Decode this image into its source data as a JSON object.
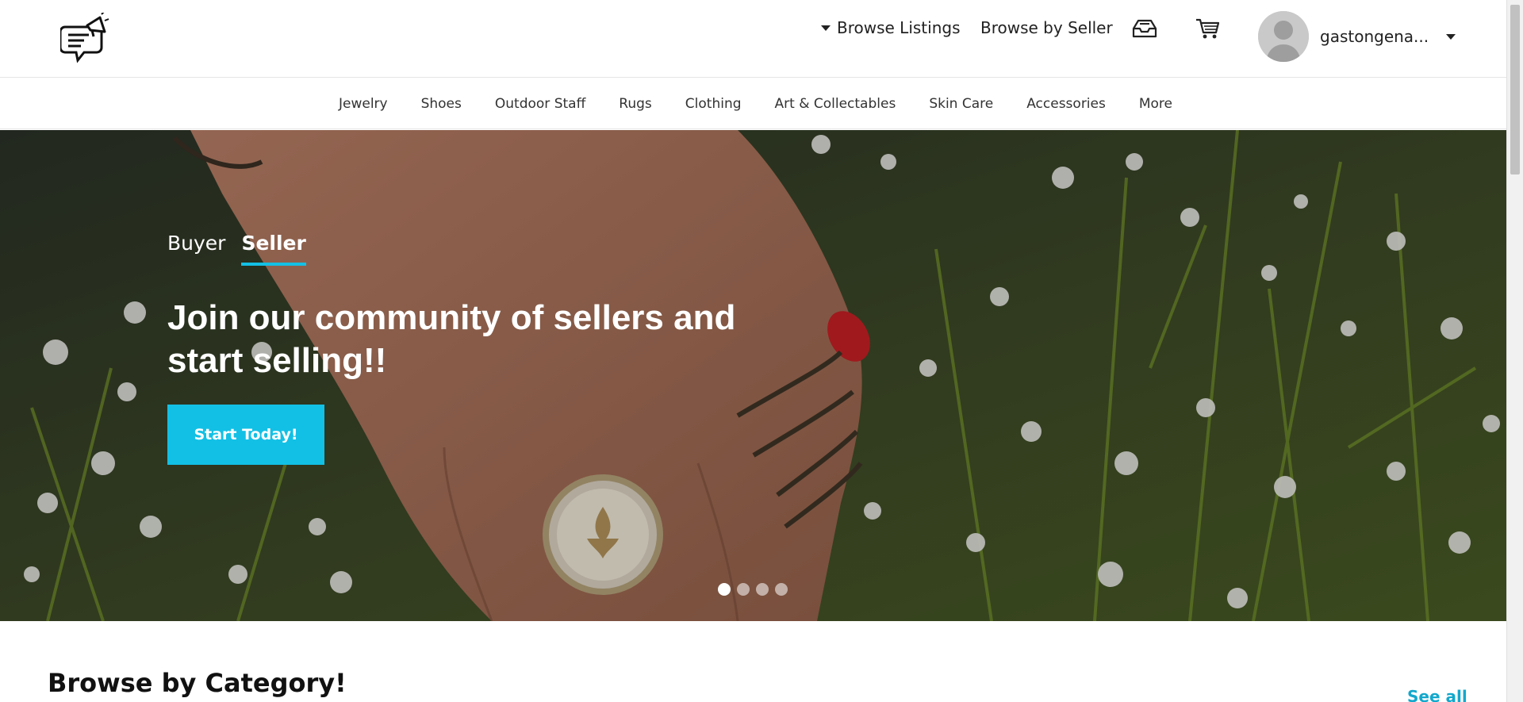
{
  "header": {
    "logo_icon": "chat-megaphone-logo-icon",
    "browse_listings_label": "Browse Listings",
    "browse_seller_label": "Browse by Seller",
    "inbox_icon": "inbox-tray-icon",
    "cart_icon": "shopping-cart-icon",
    "username": "gastongena..."
  },
  "categories": [
    "Jewelry",
    "Shoes",
    "Outdoor Staff",
    "Rugs",
    "Clothing",
    "Art & Collectables",
    "Skin Care",
    "Accessories",
    "More"
  ],
  "hero": {
    "tabs": [
      {
        "label": "Buyer",
        "active": false
      },
      {
        "label": "Seller",
        "active": true
      }
    ],
    "title": "Join our community of sellers and start selling!!",
    "cta_label": "Start Today!",
    "carousel_total": 4,
    "carousel_active": 1
  },
  "browse": {
    "title": "Browse by Category!",
    "see_all_label": "See all"
  },
  "colors": {
    "accent": "#13c0e5",
    "link": "#13a8cc",
    "text": "#222222"
  }
}
